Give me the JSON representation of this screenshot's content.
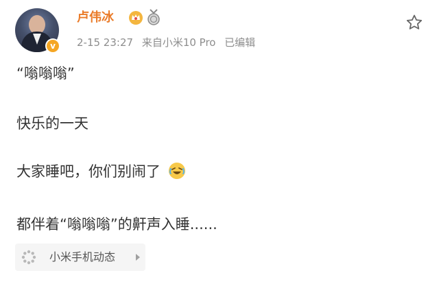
{
  "post": {
    "author": "卢伟冰",
    "date": "2-15 23:27",
    "source": "来自小米10 Pro",
    "edited": "已编辑",
    "lines": [
      "“嗡嗡嗡”",
      "快乐的一天",
      "大家睡吧，你们别闹了",
      "都伴着“嗡嗡嗡”的鼾声入睡......"
    ],
    "source_chip": {
      "label": "小米手机动态"
    }
  },
  "icons": {
    "verify": "verified-badge-icon",
    "vip": "vip-crown-icon",
    "medal": "medal-icon",
    "favorite": "star-icon",
    "emoji": "laughing-emoji-icon",
    "chip": "spinner-icon",
    "arrow": "chevron-right-icon"
  },
  "colors": {
    "name": "#ea7b29",
    "meta": "#8d8d8d",
    "body": "#333333",
    "badge": "#f5a623",
    "chip_bg": "#f5f5f5"
  }
}
